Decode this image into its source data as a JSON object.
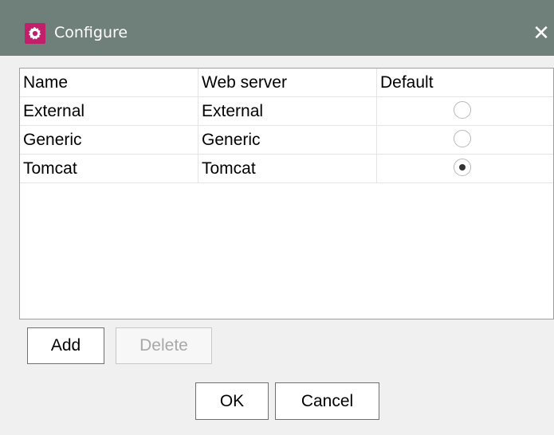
{
  "window": {
    "title": "Configure",
    "close_glyph": "✕",
    "app_icon": "gear-icon",
    "colors": {
      "titlebar": "#6f807a",
      "app_icon_bg": "#c21f6b"
    }
  },
  "table": {
    "columns": [
      "Name",
      "Web server",
      "Default"
    ],
    "rows": [
      {
        "name": "External",
        "web_server": "External",
        "default": false
      },
      {
        "name": "Generic",
        "web_server": "Generic",
        "default": false
      },
      {
        "name": "Tomcat",
        "web_server": "Tomcat",
        "default": true
      }
    ]
  },
  "buttons": {
    "add": "Add",
    "delete": "Delete",
    "ok": "OK",
    "cancel": "Cancel"
  }
}
